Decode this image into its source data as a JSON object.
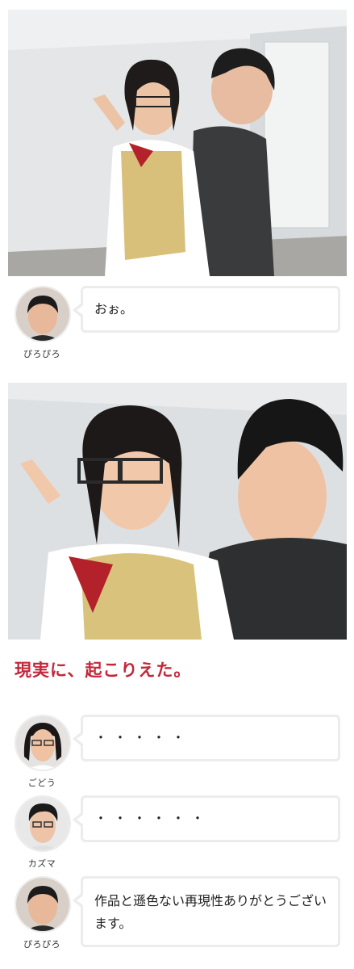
{
  "photos": [
    {
      "alt": "photo-1"
    },
    {
      "alt": "photo-2"
    }
  ],
  "conversation_1": [
    {
      "speaker": "ぴろぴろ",
      "text": "おぉ。"
    }
  ],
  "headline": "現実に、起こりえた。",
  "conversation_2": [
    {
      "speaker": "ごどう",
      "text": "・・・・・"
    },
    {
      "speaker": "カズマ",
      "text": "・・・・・・"
    },
    {
      "speaker": "ぴろぴろ",
      "text": "作品と遜色ない再現性ありがとうございます。"
    }
  ],
  "colors": {
    "headline": "#c4273a",
    "bubble_border": "#ececec"
  }
}
